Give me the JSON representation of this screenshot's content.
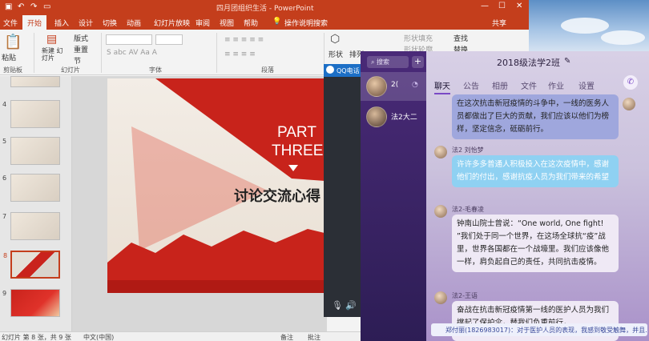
{
  "ppt": {
    "title": "四月团组织生活 - PowerPoint",
    "user": "共享",
    "tabs": [
      "文件",
      "开始",
      "插入",
      "设计",
      "切换",
      "动画",
      "幻灯片放映",
      "审阅",
      "视图",
      "帮助",
      "操作说明搜索"
    ],
    "active_tab": "开始",
    "ribbon": {
      "paste": "粘贴",
      "clipboard": "剪贴板",
      "new_slide": "新建\n幻灯片",
      "layout": "版式",
      "reset": "重置",
      "section": "节",
      "slides": "幻灯片",
      "font": "字体",
      "paragraph": "段落",
      "shape": "形状",
      "arrange": "排列",
      "fill": "形状填充",
      "outline": "形状轮廓",
      "find": "查找",
      "replace": "替换",
      "font_sample": "S abc AV Aa A"
    },
    "slide_numbers": [
      "4",
      "5",
      "6",
      "7",
      "8",
      "9"
    ],
    "slide_text": {
      "part": "PART",
      "three": "THREE",
      "heading": "讨论交流心得"
    },
    "status": {
      "slide_info": "幻灯片 第 8 张，共 9 张",
      "language": "中文(中国)",
      "notes": "备注",
      "comments": "批注"
    }
  },
  "qq_small": {
    "title": "QQ电话"
  },
  "qq": {
    "search_placeholder": "搜索",
    "group_name": "2018级法学2班",
    "conversations": [
      {
        "name": "2(",
        "muted": true
      },
      {
        "name": "法2大二",
        "muted": false
      }
    ],
    "tabs": [
      "聊天",
      "公告",
      "相册",
      "文件",
      "作业",
      "设置"
    ],
    "active_tab": "聊天",
    "messages": [
      {
        "sender": "",
        "text": "在这次抗击新冠疫情的斗争中，一线的医务人员都做出了巨大的贡献，我们应该以他们为榜样，坚定信念，砥砺前行。",
        "style": "sel"
      },
      {
        "sender": "法2 刘怡梦",
        "text": "许许多多普通人积极投入在这次疫情中，感谢他们的付出，感谢抗疫人员为我们带来的希望",
        "style": "blue"
      },
      {
        "sender": "法2-毛春凌",
        "text": "钟南山院士曾说：“One world, One fight! ”我们处于同一个世界，在这场全球抗“疫”战里，世界各国都在一个战壕里。我们应该像他一样，肩负起自己的责任，共同抗击疫情。",
        "style": "white"
      },
      {
        "sender": "法2-王语",
        "text": "奋战在抗击新冠疫情第一线的医护人员为我们撑起了保护伞，替我们负重前行，",
        "style": "white"
      }
    ],
    "notification": "郑付丽(1826983017)：对于医护人员的表现，我感到敬受触舞，并且..."
  }
}
